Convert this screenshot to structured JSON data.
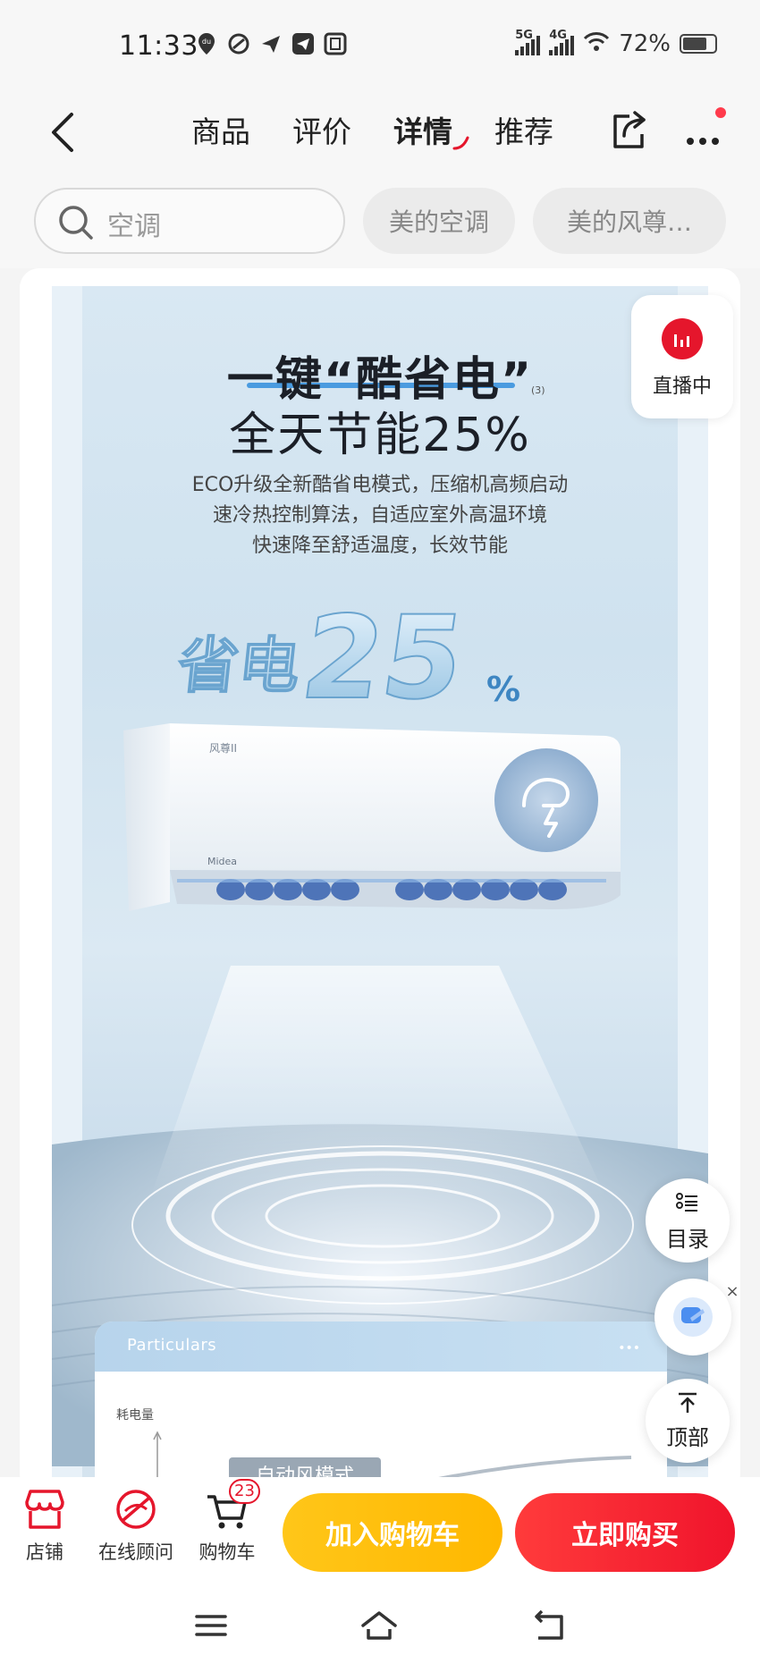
{
  "status_bar": {
    "time": "11:33",
    "net1": "5G",
    "net2": "4G",
    "battery": "72%"
  },
  "nav": {
    "tabs": [
      "商品",
      "评价",
      "详情",
      "推荐"
    ],
    "active_tab": "详情"
  },
  "search": {
    "placeholder": "空调",
    "chips": [
      "美的空调",
      "美的风尊…"
    ]
  },
  "banner": {
    "headline1": "一键“酷省电”",
    "headline2": "全天节能25%",
    "footnote": "(3)",
    "desc": [
      "ECO升级全新酷省电模式，压缩机高频启动",
      "速冷热控制算法，自适应室外高温环境",
      "快速降至舒适温度，长效节能"
    ],
    "big_text": "省电",
    "big_number": "25",
    "big_unit": "%",
    "brand": "Midea",
    "model": "风尊II",
    "particulars_title": "Particulars",
    "particulars_dots": "•••",
    "particulars_axis": "耗电量",
    "particulars_mode": "自动风模式"
  },
  "floating": {
    "live": "直播中",
    "catalog": "目录",
    "top": "顶部",
    "close": "×"
  },
  "action_bar": {
    "store": "店铺",
    "advisor": "在线顾问",
    "cart": "购物车",
    "cart_count": "23",
    "add_to_cart": "加入购物车",
    "buy_now": "立即购买"
  },
  "colors": {
    "accent_red": "#e5162c",
    "accent_yellow": "#ffc619",
    "banner_blue": "#cfe2ef"
  }
}
